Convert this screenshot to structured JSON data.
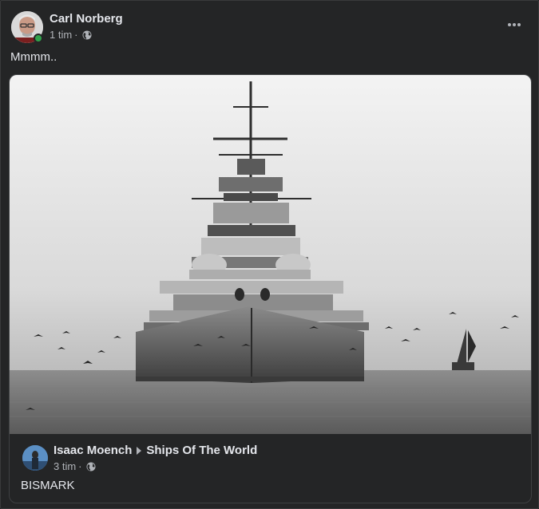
{
  "post": {
    "author": "Carl Norberg",
    "time": "1 tim",
    "separator": "·",
    "privacy_icon": "globe-icon",
    "text": "Mmmm..",
    "more_icon": "more-horizontal-icon"
  },
  "shared_post": {
    "author": "Isaac Moench",
    "group": "Ships Of The World",
    "time": "3 tim",
    "separator": "·",
    "privacy_icon": "globe-icon",
    "text": "BISMARK",
    "photo_subject": "battleship-photo"
  },
  "colors": {
    "background": "#242526",
    "text_primary": "#e4e6eb",
    "text_secondary": "#b0b3b8",
    "online": "#31a24c"
  }
}
